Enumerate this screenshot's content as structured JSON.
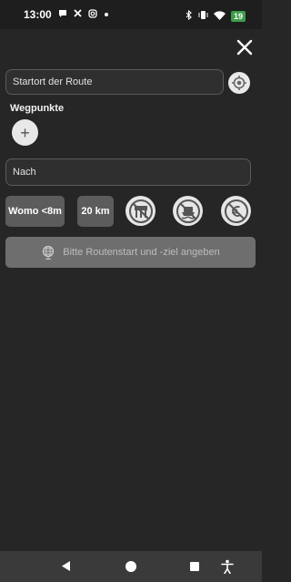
{
  "status_bar": {
    "time": "13:00",
    "battery": "19",
    "icons": [
      "chat-bubble-icon",
      "x-icon",
      "instagram-icon",
      "dot-icon",
      "bluetooth-icon",
      "vibrate-icon",
      "wifi-icon",
      "battery-icon"
    ]
  },
  "route_form": {
    "start_placeholder": "Startort der Route",
    "waypoints_label": "Wegpunkte",
    "add_waypoint_glyph": "+",
    "destination_placeholder": "Nach",
    "vehicle_chip": "Womo <8m",
    "distance_chip": "20 km",
    "avoid_options": [
      "no-highway-icon",
      "no-ferry-icon",
      "no-toll-icon"
    ],
    "route_button_label": "Bitte Routenstart und -ziel angeben"
  },
  "nav_bar": {
    "buttons": [
      "back-icon",
      "home-icon",
      "recents-icon",
      "accessibility-icon"
    ]
  },
  "colors": {
    "background": "#262626",
    "field": "#2f2f2f",
    "chip": "#5c5c5c",
    "disabled_button": "#6e6e6e"
  }
}
